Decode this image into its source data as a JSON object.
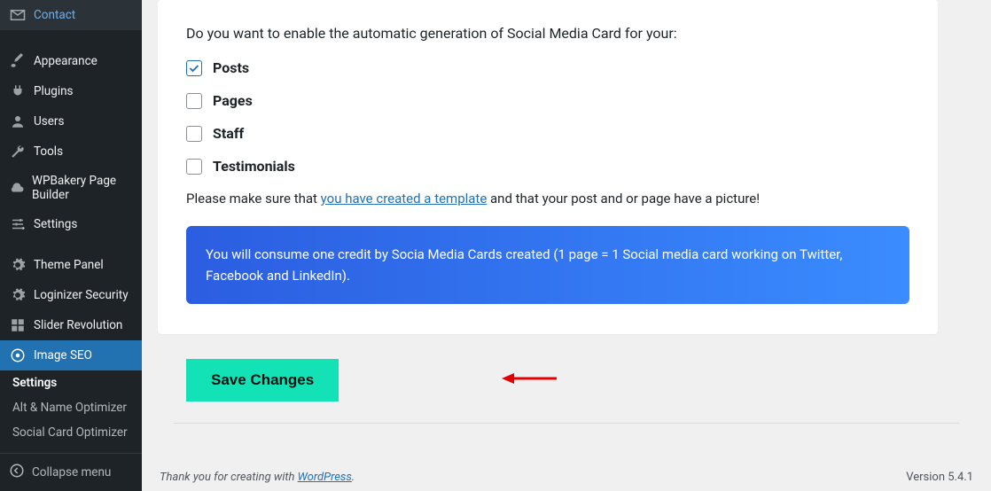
{
  "sidebar": {
    "items": [
      {
        "label": "Contact",
        "icon": "mail"
      },
      {
        "label": "Appearance",
        "icon": "brush"
      },
      {
        "label": "Plugins",
        "icon": "plug"
      },
      {
        "label": "Users",
        "icon": "user"
      },
      {
        "label": "Tools",
        "icon": "wrench"
      },
      {
        "label": "WPBakery Page Builder",
        "icon": "cloud"
      },
      {
        "label": "Settings",
        "icon": "sliders"
      },
      {
        "label": "Theme Panel",
        "icon": "gear"
      },
      {
        "label": "Loginizer Security",
        "icon": "gear"
      },
      {
        "label": "Slider Revolution",
        "icon": "grid"
      },
      {
        "label": "Image SEO",
        "icon": "image"
      }
    ],
    "subitems": [
      "Settings",
      "Alt & Name Optimizer",
      "Social Card Optimizer"
    ],
    "collapse_label": "Collapse menu"
  },
  "content": {
    "lead": "Do you want to enable the automatic generation of Social Media Card for your:",
    "options": [
      {
        "label": "Posts",
        "checked": true
      },
      {
        "label": "Pages",
        "checked": false
      },
      {
        "label": "Staff",
        "checked": false
      },
      {
        "label": "Testimonials",
        "checked": false
      }
    ],
    "note_prefix": "Please make sure that ",
    "note_link_text": "you have created a template",
    "note_suffix": " and that your post and or page have a picture!",
    "banner_text": "You will consume one credit by Socia Media Cards created (1 page = 1 Social media card working on Twitter, Facebook and LinkedIn).",
    "save_label": "Save Changes"
  },
  "footer": {
    "thank_prefix": "Thank you for creating with ",
    "thank_link": "WordPress",
    "thank_suffix": ".",
    "version": "Version 5.4.1"
  }
}
